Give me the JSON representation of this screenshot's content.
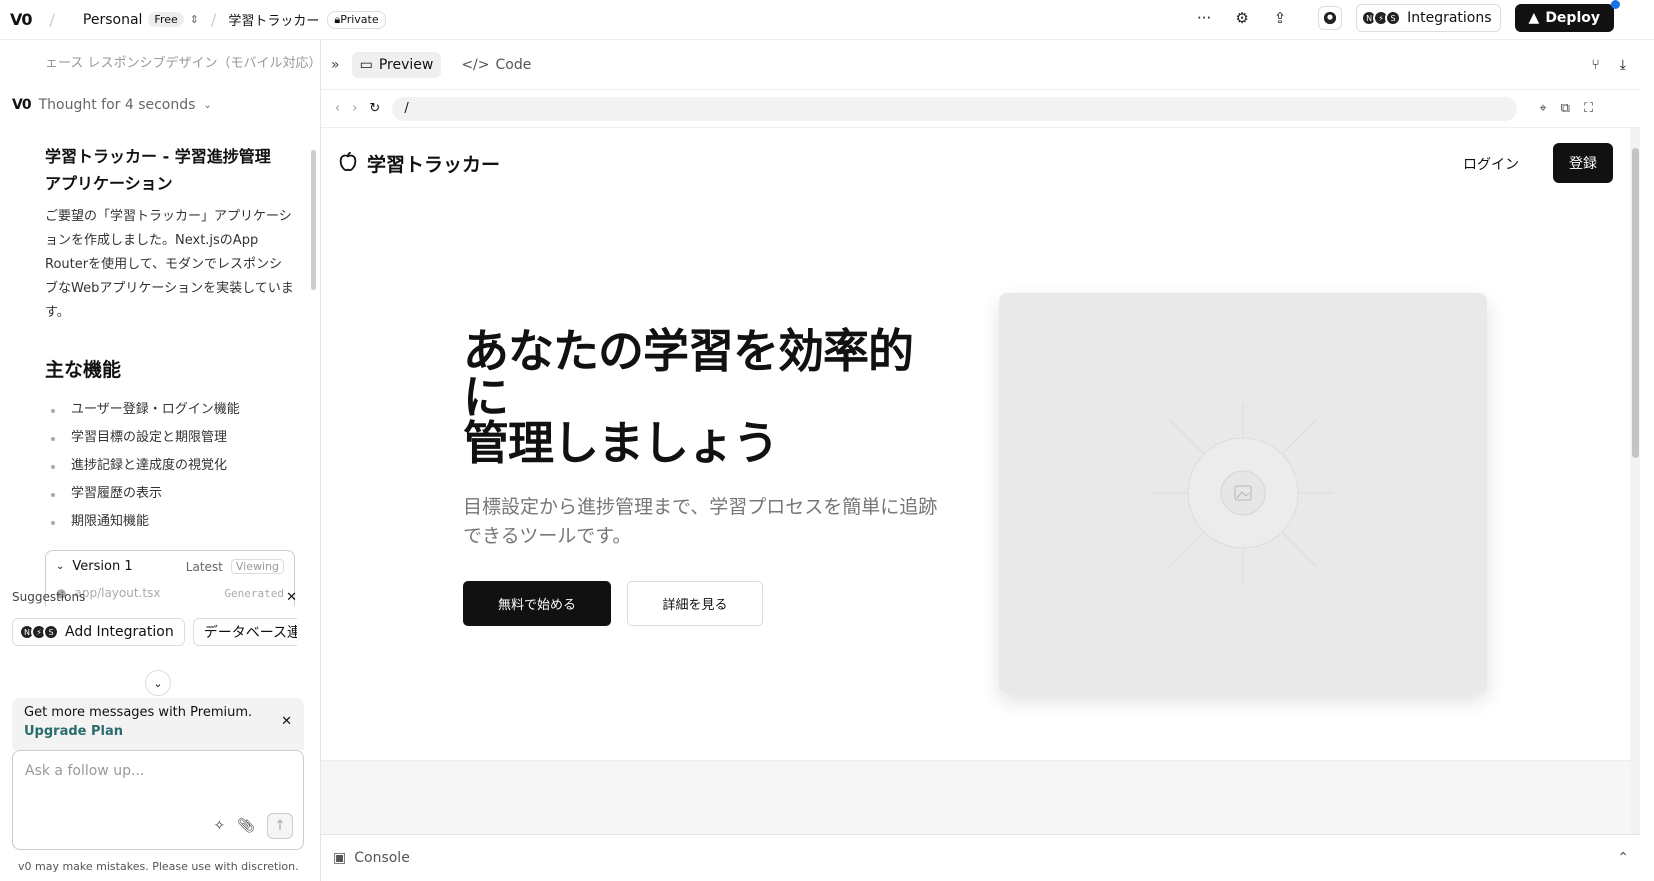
{
  "topbar": {
    "logo": "V0",
    "separator": "/",
    "workspace": "Personal",
    "plan_badge": "Free",
    "project_name": "学習トラッカー",
    "visibility": "Private",
    "integrations_label": "Integrations",
    "deploy_label": "Deploy"
  },
  "chat": {
    "faded_line": "ェース レスポンシブデザイン（モバイル対応）",
    "thought": "Thought for 4 seconds",
    "heading": "学習トラッカー - 学習進捗管理アプリケーション",
    "paragraph": "ご要望の「学習トラッカー」アプリケーションを作成しました。Next.jsのApp Routerを使用して、モダンでレスポンシブなWebアプリケーションを実装しています。",
    "features_heading": "主な機能",
    "features": [
      "ユーザー登録・ログイン機能",
      "学習目標の設定と期限管理",
      "進捗記録と達成度の視覚化",
      "学習履歴の表示",
      "期限通知機能"
    ],
    "version": {
      "label": "Version 1",
      "latest": "Latest",
      "viewing": "Viewing",
      "file": "app/layout.tsx",
      "file_status": "Generated"
    }
  },
  "suggestions": {
    "label": "Suggestions",
    "items": [
      "Add Integration",
      "データベース連携の"
    ]
  },
  "premium": {
    "text": "Get more messages with Premium.",
    "link": "Upgrade Plan"
  },
  "composer": {
    "placeholder": "Ask a follow up..."
  },
  "disclaimer": "v0 may make mistakes. Please use with discretion.",
  "preview": {
    "tabs": [
      "Preview",
      "Code"
    ],
    "url": "/",
    "console_label": "Console"
  },
  "site": {
    "brand": "学習トラッカー",
    "login": "ログイン",
    "register": "登録",
    "hero_title_line1": "あなたの学習を効率的に",
    "hero_title_line2": "管理しましょう",
    "hero_subtitle": "目標設定から進捗管理まで、学習プロセスを簡単に追跡できるツールです。",
    "cta_primary": "無料で始める",
    "cta_secondary": "詳細を見る"
  }
}
